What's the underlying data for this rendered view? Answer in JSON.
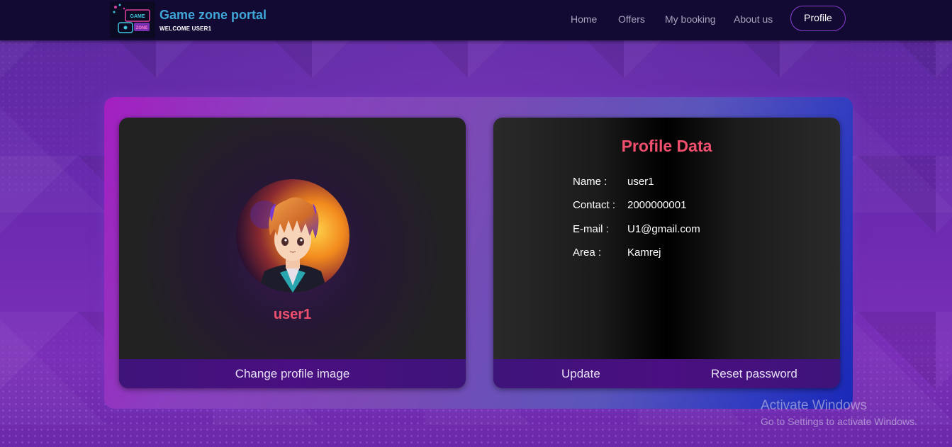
{
  "header": {
    "brand_title": "Game zone portal",
    "welcome_text": "WELCOME USER1",
    "logo_text": "GAME ZONE",
    "nav": {
      "home": "Home",
      "offers": "Offers",
      "my_booking": "My booking",
      "about_us": "About us",
      "profile": "Profile"
    }
  },
  "profile_card": {
    "username": "user1",
    "change_image_label": "Change profile image"
  },
  "profile_data": {
    "title": "Profile Data",
    "fields": [
      {
        "label": "Name :",
        "value": "user1"
      },
      {
        "label": "Contact :",
        "value": "2000000001"
      },
      {
        "label": "E-mail :",
        "value": "U1@gmail.com"
      },
      {
        "label": "Area :",
        "value": "Kamrej"
      }
    ],
    "update_label": "Update",
    "reset_label": "Reset password"
  },
  "watermark": {
    "title": "Activate Windows",
    "subtitle": "Go to Settings to activate Windows."
  },
  "colors": {
    "header_bg": "#120a33",
    "brand_title": "#3fa7d8",
    "accent_pink": "#f0506e",
    "profile_button_border": "#8a3fd0",
    "card_footer": "#4a0f80"
  }
}
